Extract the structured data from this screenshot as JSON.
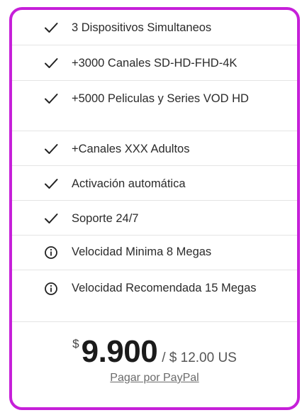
{
  "plan": {
    "features": [
      {
        "icon": "check-icon",
        "label": "3 Dispositivos Simultaneos"
      },
      {
        "icon": "check-icon",
        "label": "+3000 Canales SD-HD-FHD-4K"
      },
      {
        "icon": "check-icon",
        "label": "+5000 Peliculas y Series VOD HD"
      },
      {
        "icon": "check-icon",
        "label": "+Canales XXX Adultos"
      },
      {
        "icon": "check-icon",
        "label": "Activación automática"
      },
      {
        "icon": "check-icon",
        "label": "Soporte 24/7"
      },
      {
        "icon": "info-icon",
        "label": "Velocidad Minima 8 Megas"
      },
      {
        "icon": "info-icon",
        "label": "Velocidad Recomendada 15 Megas"
      }
    ],
    "price": {
      "currency_symbol": "$",
      "amount": "9.900",
      "alt_price": "/ $ 12.00 US"
    },
    "paypal_link_label": "Pagar por PayPal"
  },
  "colors": {
    "card_border": "#c61fd9",
    "divider": "#e4e4e4",
    "text": "#2b2b2b"
  }
}
